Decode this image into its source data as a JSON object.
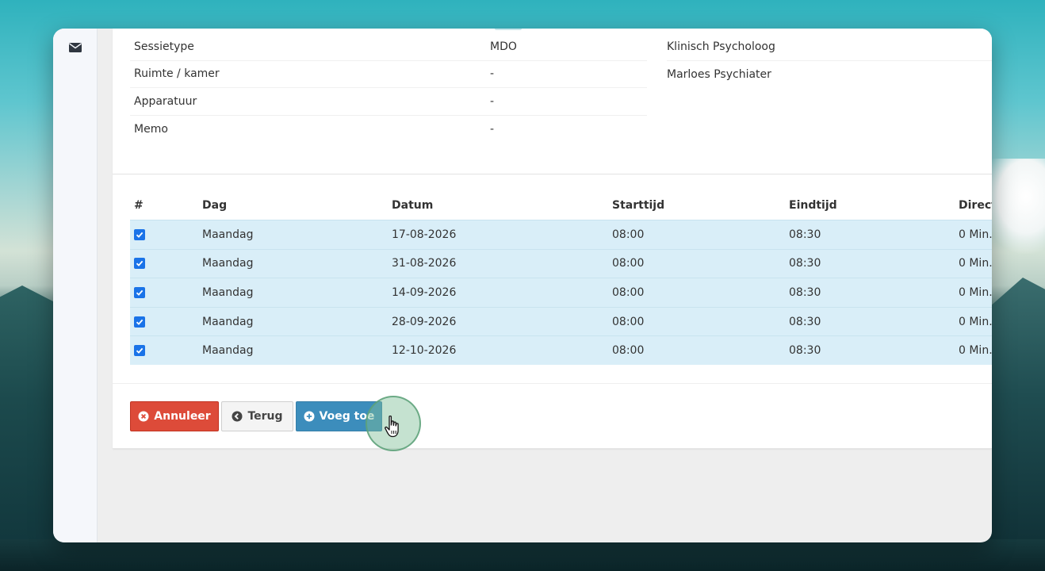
{
  "info": {
    "rows": [
      {
        "label": "Sessietype",
        "value": "MDO"
      },
      {
        "label": "Ruimte / kamer",
        "value": "-"
      },
      {
        "label": "Apparatuur",
        "value": "-"
      },
      {
        "label": "Memo",
        "value": "-"
      }
    ],
    "persons": [
      "Klinisch Psycholoog",
      "Marloes Psychiater"
    ]
  },
  "schedule": {
    "headers": {
      "num": "#",
      "dag": "Dag",
      "datum": "Datum",
      "starttijd": "Starttijd",
      "eindtijd": "Eindtijd",
      "direct": "Direct"
    },
    "rows": [
      {
        "checked": true,
        "dag": "Maandag",
        "datum": "17-08-2026",
        "start": "08:00",
        "eind": "08:30",
        "direct": "0 Min."
      },
      {
        "checked": true,
        "dag": "Maandag",
        "datum": "31-08-2026",
        "start": "08:00",
        "eind": "08:30",
        "direct": "0 Min."
      },
      {
        "checked": true,
        "dag": "Maandag",
        "datum": "14-09-2026",
        "start": "08:00",
        "eind": "08:30",
        "direct": "0 Min."
      },
      {
        "checked": true,
        "dag": "Maandag",
        "datum": "28-09-2026",
        "start": "08:00",
        "eind": "08:30",
        "direct": "0 Min."
      },
      {
        "checked": true,
        "dag": "Maandag",
        "datum": "12-10-2026",
        "start": "08:00",
        "eind": "08:30",
        "direct": "0 Min."
      }
    ]
  },
  "buttons": {
    "cancel": "Annuleer",
    "back": "Terug",
    "add": "Voeg toe"
  },
  "icons": {
    "sidebar": "envelope-icon",
    "cancel": "times-circle-icon",
    "back": "arrow-circle-left-icon",
    "add": "plus-circle-icon",
    "cursor": "hand-pointer-icon"
  },
  "colors": {
    "danger": "#dd4b39",
    "primary": "#3c8dbc",
    "row_highlight": "#d9eef8",
    "checkbox": "#1a73e8"
  }
}
